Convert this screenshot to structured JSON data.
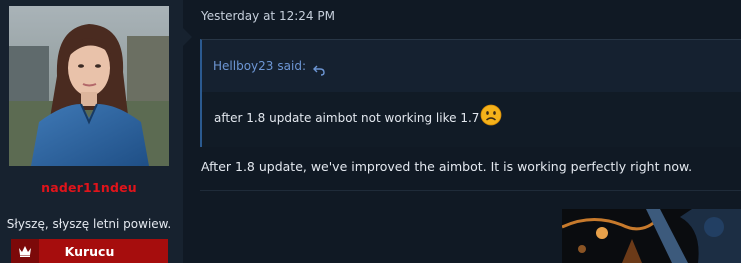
{
  "user": {
    "username": "nader11ndeu",
    "title": "Słyszę, słyszę letni powiew.",
    "rank": "Kurucu"
  },
  "post": {
    "timestamp": "Yesterday at 12:24 PM",
    "quote": {
      "author": "Hellboy23",
      "said_label": "said:",
      "text": "after 1.8 update aimbot not working like 1.7"
    },
    "reply": "After 1.8 update, we've improved the aimbot. It is working perfectly right now."
  },
  "colors": {
    "background": "#101924",
    "sidebar": "#17222f",
    "username": "#e0141b",
    "rank_badge": "#a60d0d",
    "quote_author": "#6d96d4",
    "quote_border": "#2b5a90"
  },
  "icons": {
    "rank": "crown-icon",
    "quote_jump": "reply-arrow-icon",
    "emoji": "frowning-face-emoji"
  }
}
